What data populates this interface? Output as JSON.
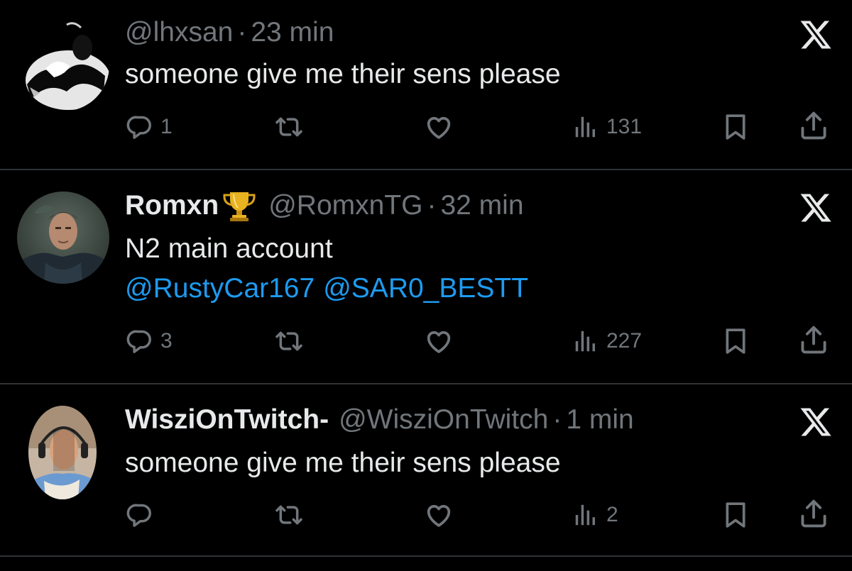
{
  "tweets": [
    {
      "handle": "@lhxsan",
      "separator": "·",
      "time": "23 min",
      "text": "someone give me their sens please",
      "replies": "1",
      "views": "131"
    },
    {
      "display_name": "Romxn",
      "handle": "@RomxnTG",
      "separator": "·",
      "time": "32 min",
      "text": "N2 main account",
      "mentions": [
        "@RustyCar167",
        "@SAR0_BESTT"
      ],
      "replies": "3",
      "views": "227"
    },
    {
      "display_name": "WisziOnTwitch-",
      "handle": "@WisziOnTwitch",
      "separator": "·",
      "time": "1 min",
      "text": "someone give me their sens please",
      "views": "2"
    }
  ],
  "icons": {
    "brand": "x-logo-icon",
    "reply": "reply-icon",
    "retweet": "retweet-icon",
    "like": "heart-icon",
    "views": "views-icon",
    "bookmark": "bookmark-icon",
    "share": "share-icon",
    "badge": "trophy-icon"
  },
  "colors": {
    "background": "#000000",
    "primary_text": "#e7e9ea",
    "secondary_text": "#71767b",
    "link": "#1d9bf0",
    "divider": "#2f3336"
  }
}
